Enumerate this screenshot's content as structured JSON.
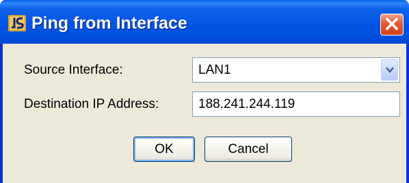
{
  "window": {
    "title": "Ping from Interface",
    "app_icon": "app-icon",
    "close_icon": "close-icon"
  },
  "form": {
    "source_interface": {
      "label": "Source Interface:",
      "value": "LAN1",
      "dropdown_icon": "chevron-down-icon"
    },
    "destination_ip": {
      "label": "Destination IP Address:",
      "value": "188.241.244.119"
    }
  },
  "buttons": {
    "ok_label": "OK",
    "cancel_label": "Cancel"
  },
  "colors": {
    "titlebar": "#0055e5",
    "close_button": "#d34016",
    "dialog_background": "#ece9d8",
    "field_border": "#7f9db9"
  }
}
